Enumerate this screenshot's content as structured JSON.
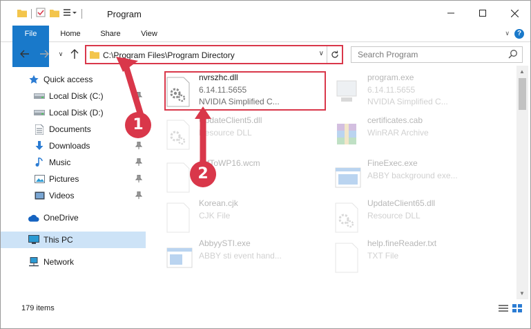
{
  "window": {
    "title": "Program",
    "controls": [
      "minimize-icon",
      "maximize-icon",
      "close-icon"
    ]
  },
  "ribbon": {
    "tabs": [
      {
        "label": "File",
        "active": true
      },
      {
        "label": "Home"
      },
      {
        "label": "Share"
      },
      {
        "label": "View"
      }
    ],
    "help_label": "?"
  },
  "address": {
    "path": "C:\\Program Files\\Program Directory",
    "highlight_color": "#d9374a"
  },
  "search": {
    "placeholder": "Search Program"
  },
  "sidebar": {
    "items": [
      {
        "label": "Quick access",
        "icon": "star-icon"
      },
      {
        "label": "Local Disk (C:)",
        "icon": "drive-icon",
        "pinned": true
      },
      {
        "label": "Local Disk (D:)",
        "icon": "drive-icon"
      },
      {
        "label": "Documents",
        "icon": "documents-icon",
        "pinned": true
      },
      {
        "label": "Downloads",
        "icon": "download-icon",
        "pinned": true
      },
      {
        "label": "Music",
        "icon": "music-icon",
        "pinned": true
      },
      {
        "label": "Pictures",
        "icon": "pictures-icon",
        "pinned": true
      },
      {
        "label": "Videos",
        "icon": "videos-icon",
        "pinned": true
      },
      {
        "label": "OneDrive",
        "icon": "cloud-icon"
      },
      {
        "label": "This PC",
        "icon": "computer-icon",
        "selected": true
      },
      {
        "label": "Network",
        "icon": "network-icon"
      }
    ]
  },
  "files": [
    {
      "name": "nvrszhc.dll",
      "line2": "6.14.11.5655",
      "line3": "NVIDIA Simplified C...",
      "icon": "dll-gear-icon",
      "highlighted": true
    },
    {
      "name": "program.exe",
      "line2": "6.14.11.5655",
      "line3": "NVIDIA Simplified C...",
      "icon": "exe-icon"
    },
    {
      "name": "UpdateClient5.dll",
      "line2": "Resource DLL",
      "line3": "",
      "icon": "dll-gear-icon"
    },
    {
      "name": "certificates.cab",
      "line2": "WinRAR Archive",
      "line3": "",
      "icon": "archive-icon"
    },
    {
      "name": "RtfToWP16.wcm",
      "line2": "",
      "line3": "",
      "icon": "file-icon"
    },
    {
      "name": "FineExec.exe",
      "line2": "ABBY background exe...",
      "line3": "",
      "icon": "window-exe-icon"
    },
    {
      "name": "Korean.cjk",
      "line2": "CJK File",
      "line3": "",
      "icon": "file-icon"
    },
    {
      "name": "UpdateClient65.dll",
      "line2": "Resource DLL",
      "line3": "",
      "icon": "dll-gear-icon"
    },
    {
      "name": "AbbyySTI.exe",
      "line2": "ABBY sti event hand...",
      "line3": "",
      "icon": "window-exe-icon"
    },
    {
      "name": "help.fineReader.txt",
      "line2": "TXT File",
      "line3": "",
      "icon": "file-icon"
    }
  ],
  "status": {
    "item_count": "179 items"
  },
  "callouts": [
    {
      "number": "1"
    },
    {
      "number": "2"
    }
  ],
  "colors": {
    "accent": "#1979ca",
    "annotation": "#d9374a",
    "selection": "#cde3f7"
  }
}
